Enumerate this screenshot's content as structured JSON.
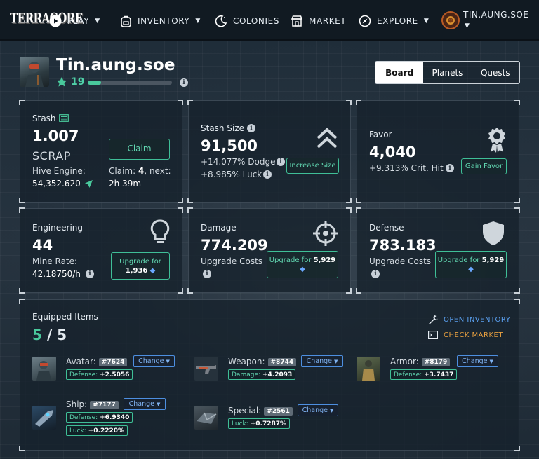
{
  "nav": {
    "brand": "TERRACORE",
    "items": [
      {
        "label": "PLAY",
        "icon": "play-circle-icon"
      },
      {
        "label": "INVENTORY",
        "icon": "backpack-icon"
      },
      {
        "label": "COLONIES",
        "icon": "moon-icon"
      },
      {
        "label": "MARKET",
        "icon": "shop-icon"
      },
      {
        "label": "EXPLORE",
        "icon": "compass-icon"
      }
    ],
    "user": "TIN.AUNG.SOE"
  },
  "profile": {
    "name": "Tin.aung.soe",
    "level": "19",
    "xp_fraction": 0.16
  },
  "tabs": [
    {
      "label": "Board",
      "active": true
    },
    {
      "label": "Planets",
      "active": false
    },
    {
      "label": "Quests",
      "active": false
    }
  ],
  "stash": {
    "title": "Stash",
    "value": "1.007",
    "unit": "SCRAP",
    "claim_label": "Claim",
    "hive_label": "Hive Engine:",
    "hive_value": "54,352.620",
    "claim_line_prefix": "Claim: ",
    "claim_count": "4",
    "claim_line_suffix": ", next:",
    "next_time": "2h 39m"
  },
  "stash_size": {
    "title": "Stash Size",
    "value": "91,500",
    "dodge": "+14.077% Dodge",
    "luck": "+8.985% Luck",
    "button": "Increase Size"
  },
  "favor": {
    "title": "Favor",
    "value": "4,040",
    "crit": "+9.313% Crit. Hit",
    "button": "Gain Favor"
  },
  "engineering": {
    "title": "Engineering",
    "value": "44",
    "rate_label": "Mine Rate:",
    "rate_value": "42.18750/h",
    "button_prefix": "Upgrade for",
    "cost": "1,936"
  },
  "damage": {
    "title": "Damage",
    "value": "774.209",
    "costs_label": "Upgrade Costs",
    "button_prefix": "Upgrade for",
    "cost": "5,929"
  },
  "defense": {
    "title": "Defense",
    "value": "783.183",
    "costs_label": "Upgrade Costs",
    "button_prefix": "Upgrade for",
    "cost": "5,929"
  },
  "equipped": {
    "title": "Equipped Items",
    "count": "5",
    "sep": "/",
    "total": "5",
    "open_inventory": "OPEN INVENTORY",
    "check_market": "CHECK MARKET",
    "change_label": "Change",
    "items": [
      {
        "name": "Avatar:",
        "id": "#7624",
        "stats": [
          {
            "label": "Defense:",
            "value": "+2.5056"
          }
        ]
      },
      {
        "name": "Weapon:",
        "id": "#8744",
        "stats": [
          {
            "label": "Damage:",
            "value": "+4.2093"
          }
        ]
      },
      {
        "name": "Armor:",
        "id": "#8179",
        "stats": [
          {
            "label": "Defense:",
            "value": "+3.7437"
          }
        ]
      },
      {
        "name": "Ship:",
        "id": "#7177",
        "stats": [
          {
            "label": "Defense:",
            "value": "+6.9340"
          },
          {
            "label": "Luck:",
            "value": "+0.2220%"
          }
        ]
      },
      {
        "name": "Special:",
        "id": "#2561",
        "stats": [
          {
            "label": "Luck:",
            "value": "+0.7287%"
          }
        ]
      }
    ]
  },
  "colors": {
    "accent_green": "#49c99c",
    "link_blue": "#5aa0f0",
    "link_orange": "#e8a040"
  }
}
